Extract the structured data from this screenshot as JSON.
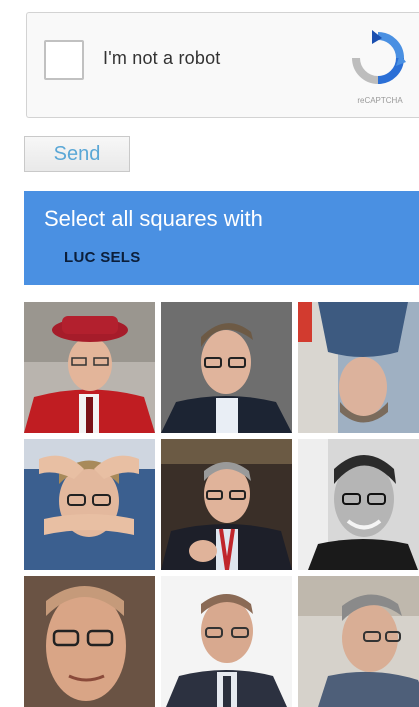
{
  "recaptcha": {
    "checkbox_label": "I'm not a robot",
    "brand": "reCAPTCHA",
    "logo_icon": "recaptcha-logo-icon"
  },
  "form": {
    "send_label": "Send"
  },
  "challenge": {
    "instruction": "Select all squares with",
    "target": "LUC SELS",
    "header_color": "#4a90e2"
  },
  "grid": {
    "rows": 3,
    "cols": 3,
    "tiles": [
      {
        "description": "man in red academic cap and gown"
      },
      {
        "description": "man with glasses in dark suit"
      },
      {
        "description": "upside-down photo of man"
      },
      {
        "description": "man holding hands over face"
      },
      {
        "description": "man in dark suit with red lanyard"
      },
      {
        "description": "black and white photo of smiling man with glasses"
      },
      {
        "description": "close-up of man with glasses"
      },
      {
        "description": "older man with glasses and tie"
      },
      {
        "description": "man with grey hair in profile"
      }
    ]
  }
}
